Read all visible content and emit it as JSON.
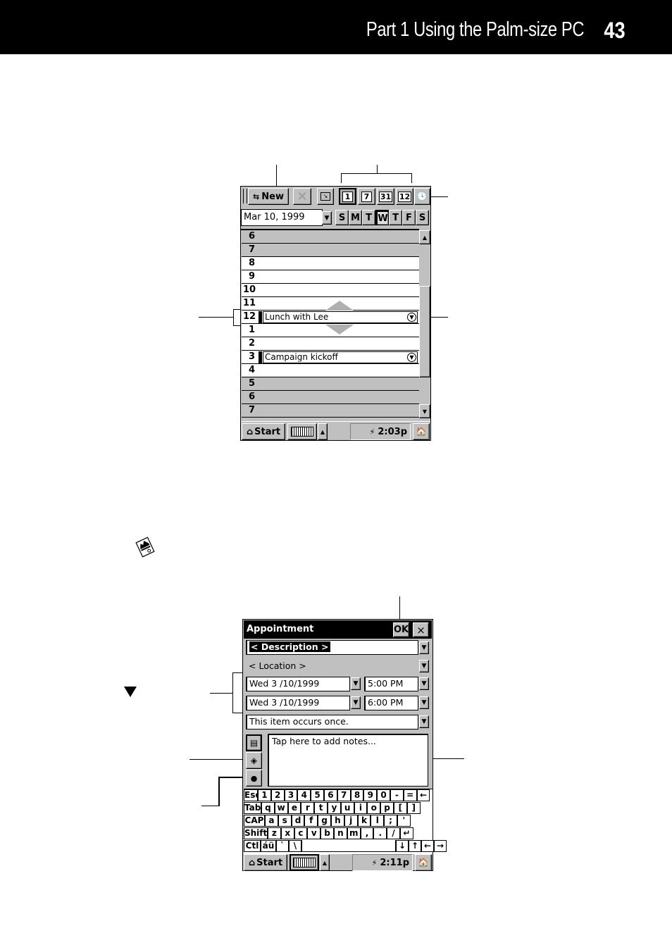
{
  "header": {
    "title": "Part 1  Using the Palm-size PC",
    "page_number": "43"
  },
  "calendar_screen": {
    "toolbar": {
      "new_label": "New",
      "view_buttons": [
        "1",
        "7",
        "31",
        "12"
      ]
    },
    "date_field": "Mar 10, 1999",
    "week_days": [
      "S",
      "M",
      "T",
      "W",
      "T",
      "F",
      "S"
    ],
    "selected_day_index": 3,
    "hours": [
      {
        "label": "6",
        "shade": "gray"
      },
      {
        "label": "7",
        "shade": "gray"
      },
      {
        "label": "8",
        "shade": "white"
      },
      {
        "label": "9",
        "shade": "white"
      },
      {
        "label": "10",
        "shade": "white"
      },
      {
        "label": "11",
        "shade": "white"
      },
      {
        "label": "12",
        "shade": "white",
        "appointment": "Lunch with Lee"
      },
      {
        "label": "1",
        "shade": "white"
      },
      {
        "label": "2",
        "shade": "white"
      },
      {
        "label": "3",
        "shade": "white",
        "appointment": "Campaign kickoff"
      },
      {
        "label": "4",
        "shade": "white"
      },
      {
        "label": "5",
        "shade": "gray"
      },
      {
        "label": "6",
        "shade": "gray"
      },
      {
        "label": "7",
        "shade": "gray"
      }
    ],
    "taskbar": {
      "start_label": "Start",
      "time": "2:03p"
    }
  },
  "appointment_screen": {
    "title": "Appointment",
    "ok_label": "OK",
    "close_label": "×",
    "description": "< Description >",
    "location": "< Location >",
    "start_date": "Wed  3 /10/1999",
    "start_time": "5:00 PM",
    "end_date": "Wed  3 /10/1999",
    "end_time": "6:00 PM",
    "recurrence": "This item occurs once.",
    "notes_placeholder": "Tap here to add notes...",
    "keyboard_rows": [
      [
        "Esc",
        "1",
        "2",
        "3",
        "4",
        "5",
        "6",
        "7",
        "8",
        "9",
        "0",
        "-",
        "=",
        "←"
      ],
      [
        "Tab",
        "q",
        "w",
        "e",
        "r",
        "t",
        "y",
        "u",
        "i",
        "o",
        "p",
        "[",
        "]"
      ],
      [
        "CAP",
        "a",
        "s",
        "d",
        "f",
        "g",
        "h",
        "j",
        "k",
        "l",
        ";",
        "'"
      ],
      [
        "Shift",
        "z",
        "x",
        "c",
        "v",
        "b",
        "n",
        "m",
        ",",
        ".",
        "/",
        "↵"
      ],
      [
        "Ctl",
        "áü",
        "`",
        "\\",
        "",
        "↓",
        "↑",
        "←",
        "→"
      ]
    ],
    "taskbar": {
      "start_label": "Start",
      "time": "2:11p"
    }
  }
}
